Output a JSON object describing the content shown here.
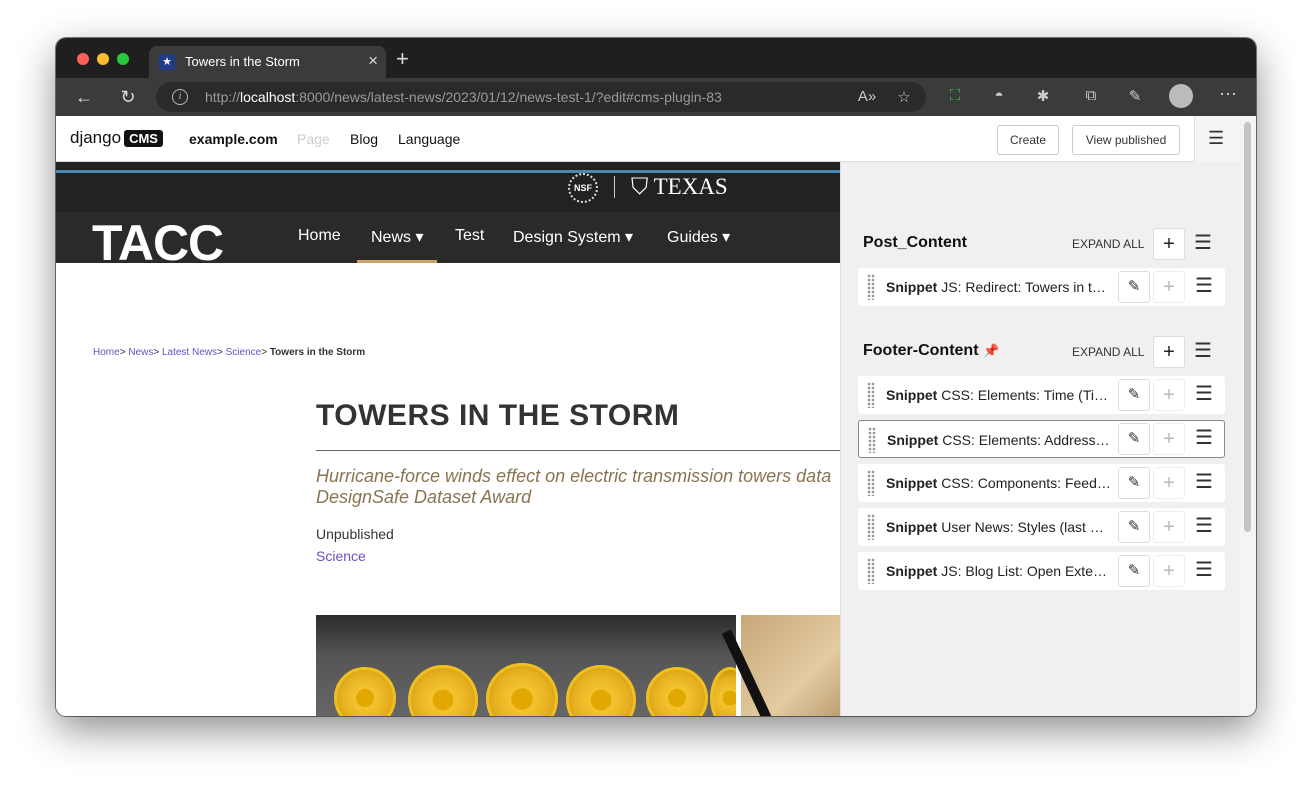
{
  "browser": {
    "tab_title": "Towers in the Storm",
    "tab_favicon": "star-icon",
    "url_host": "localhost",
    "url_prefix": "http://",
    "url_rest": ":8000/news/latest-news/2023/01/12/news-test-1/?edit#cms-plugin-83"
  },
  "cms_toolbar": {
    "logo_text": "django",
    "logo_badge": "CMS",
    "site": "example.com",
    "page": "Page",
    "blog": "Blog",
    "language": "Language",
    "create": "Create",
    "view_published": "View published"
  },
  "site": {
    "nsf": "NSF",
    "texas": "TEXAS",
    "logo": "TACC",
    "nav": [
      {
        "label": "Home"
      },
      {
        "label": "News ▾"
      },
      {
        "label": "Test"
      },
      {
        "label": "Design System ▾"
      },
      {
        "label": "Guides ▾"
      }
    ],
    "breadcrumb": [
      {
        "label": "Home"
      },
      {
        "label": "News"
      },
      {
        "label": "Latest News"
      },
      {
        "label": "Science"
      }
    ],
    "breadcrumb_current": "Towers in the Storm",
    "title": "TOWERS IN THE STORM",
    "subtitle": "Hurricane-force winds effect on electric transmission towers data DesignSafe Dataset Award",
    "status": "Unpublished",
    "category": "Science"
  },
  "structure": {
    "sections": [
      {
        "name": "Post_Content",
        "expand": "EXPAND ALL"
      },
      {
        "name": "Footer-Content",
        "expand": "EXPAND ALL"
      }
    ],
    "post_rows": [
      {
        "type": "Snippet",
        "text": "JS: Redirect: Towers in the Storm"
      }
    ],
    "footer_rows": [
      {
        "type": "Snippet",
        "text": "CSS: Elements: Time (Time Format)"
      },
      {
        "type": "Snippet",
        "text": "CSS: Elements: Address (Fixes)"
      },
      {
        "type": "Snippet",
        "text": "CSS: Components: Feed (Fixes)"
      },
      {
        "type": "Snippet",
        "text": "User News: Styles (last updated)"
      },
      {
        "type": "Snippet",
        "text": "JS: Blog List: Open External Links"
      }
    ]
  }
}
